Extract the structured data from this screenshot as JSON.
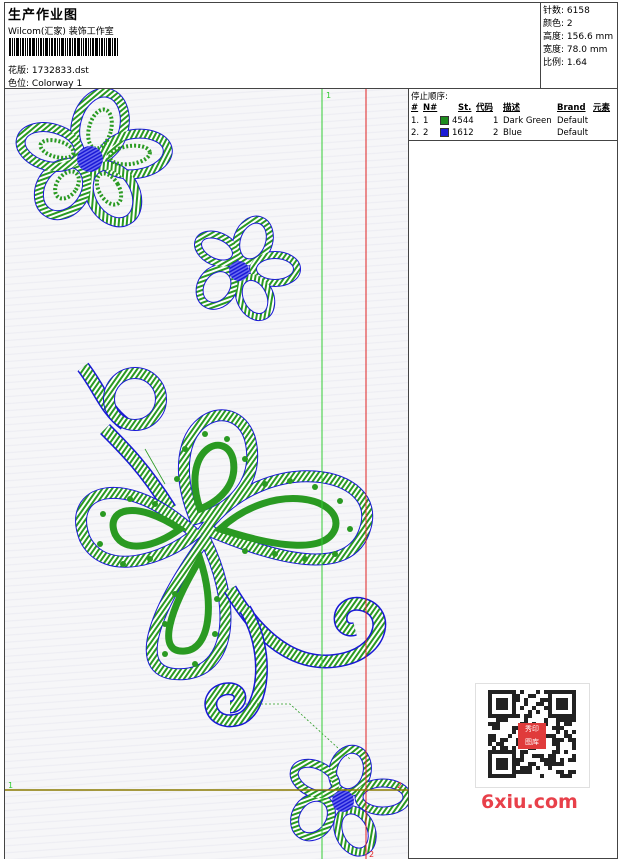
{
  "header": {
    "title": "生产作业图",
    "company": "Wilcom(汇家) 装饰工作室",
    "pattern_label": "花版:",
    "pattern_value": "1732833.dst",
    "colorway_label": "色位:",
    "colorway_value": "Colorway 1"
  },
  "stats": [
    {
      "label": "针数:",
      "value": "6158"
    },
    {
      "label": "颜色:",
      "value": "2"
    },
    {
      "label": "高度:",
      "value": "156.6 mm"
    },
    {
      "label": "宽度:",
      "value": "78.0 mm"
    },
    {
      "label": "比例:",
      "value": "1.64"
    }
  ],
  "stop_sequence": {
    "title": "停止顺序:",
    "columns": [
      "#",
      "N#",
      "St.",
      "代码",
      "描述",
      "Brand",
      "元素"
    ],
    "rows": [
      {
        "index": "1.",
        "n": "1",
        "stitches": "4544",
        "code": "1",
        "description": "Dark Green",
        "brand": "Default",
        "color": "#1e8c1e"
      },
      {
        "index": "2.",
        "n": "2",
        "stitches": "1612",
        "code": "2",
        "description": "Blue",
        "brand": "Default",
        "color": "#1a1ad6"
      }
    ]
  },
  "guides": {
    "green_top": "1",
    "green_left": "1",
    "red_right": "2",
    "red_bottom": "2"
  },
  "colors": {
    "thread_green": "#2a9a22",
    "thread_blue": "#1a1ad6",
    "guide_green": "#33cc33",
    "guide_red": "#e02020",
    "guide_olive": "#8a7a00"
  },
  "watermark": {
    "site": "6xiu.com",
    "qr_text_top": "秀印",
    "qr_text_bottom": "图库"
  }
}
